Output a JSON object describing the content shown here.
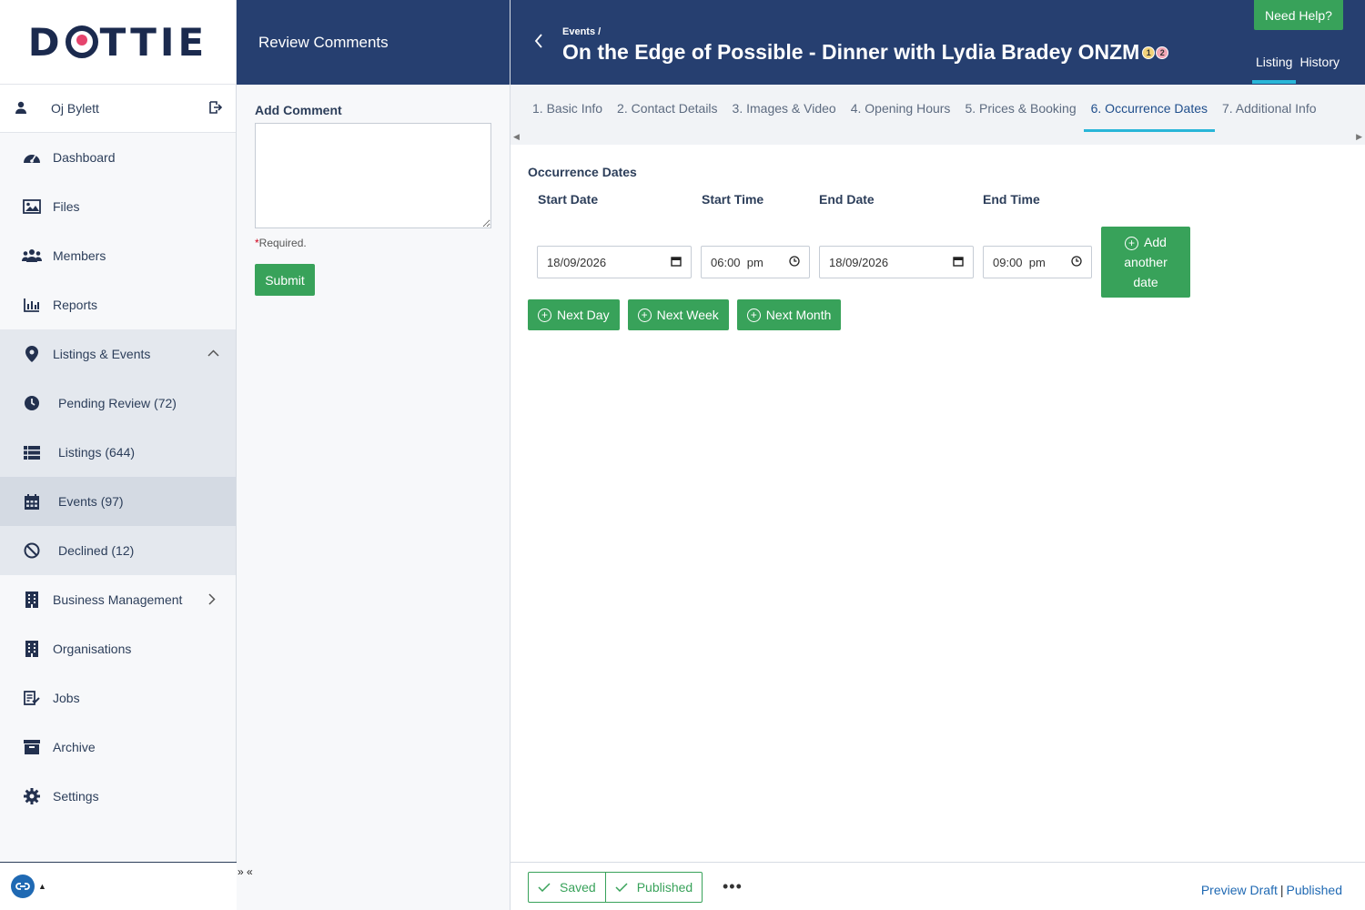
{
  "brand": {
    "logo_pre": "D",
    "logo_post": "TTIE"
  },
  "user": {
    "name": "Oj Bylett"
  },
  "nav": {
    "dashboard": "Dashboard",
    "files": "Files",
    "members": "Members",
    "reports": "Reports",
    "listings_events": "Listings & Events",
    "pending_review": "Pending Review (72)",
    "listings": "Listings (644)",
    "events": "Events (97)",
    "declined": "Declined (12)",
    "business_management": "Business Management",
    "organisations": "Organisations",
    "jobs": "Jobs",
    "archive": "Archive",
    "settings": "Settings"
  },
  "review": {
    "title": "Review Comments",
    "add_comment_label": "Add Comment",
    "comment_value": "",
    "required_text": "Required.",
    "submit_label": "Submit",
    "collapse_text": "» «"
  },
  "header": {
    "breadcrumb": "Events /",
    "title": "On the Edge of Possible - Dinner with Lydia Bradey ONZM",
    "badge_1": "1",
    "badge_2": "2",
    "help_label": "Need Help?",
    "tab_listing": "Listing",
    "tab_history": "History"
  },
  "steps": [
    "1. Basic Info",
    "2. Contact Details",
    "3. Images & Video",
    "4. Opening Hours",
    "5. Prices & Booking",
    "6. Occurrence Dates",
    "7. Additional Info"
  ],
  "occurrence": {
    "section_title": "Occurrence Dates",
    "col_start_date": "Start Date",
    "col_start_time": "Start Time",
    "col_end_date": "End Date",
    "col_end_time": "End Time",
    "start_date": "18/09/2026",
    "start_time": "06:00  pm",
    "end_date": "18/09/2026",
    "end_time": "09:00  pm",
    "add_line1": "Add",
    "add_line2": "another",
    "add_line3": "date",
    "next_day": "Next Day",
    "next_week": "Next Week",
    "next_month": "Next Month"
  },
  "footer": {
    "saved": "Saved",
    "published": "Published",
    "more": "•••",
    "preview_draft": "Preview Draft",
    "separator": "|",
    "published_link": "Published"
  },
  "colors": {
    "header_bg": "#263f70",
    "accent_green": "#38a25a",
    "tab_underline": "#29b6d8",
    "link_blue": "#1f69b3"
  }
}
